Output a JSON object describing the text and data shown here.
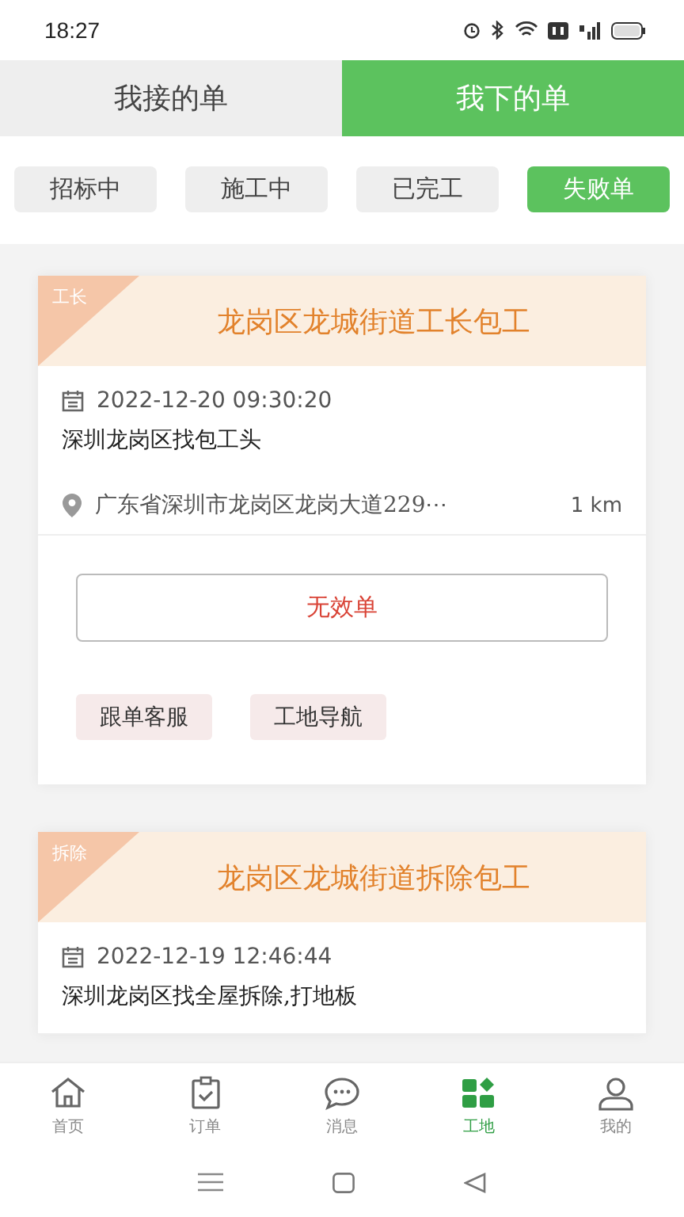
{
  "status_bar": {
    "time": "18:27"
  },
  "tabs": [
    {
      "label": "我接的单",
      "selected": false
    },
    {
      "label": "我下的单",
      "selected": true
    }
  ],
  "filters": [
    {
      "label": "招标中",
      "selected": false
    },
    {
      "label": "施工中",
      "selected": false
    },
    {
      "label": "已完工",
      "selected": false
    },
    {
      "label": "失败单",
      "selected": true
    }
  ],
  "orders": [
    {
      "tag": "工长",
      "title": "龙岗区龙城街道工长包工",
      "date": "2022-12-20 09:30:20",
      "description": "深圳龙岗区找包工头",
      "address": "广东省深圳市龙岗区龙岗大道229⋯",
      "distance": "1 km",
      "status_button": "无效单",
      "actions": [
        "跟单客服",
        "工地导航"
      ]
    },
    {
      "tag": "拆除",
      "title": "龙岗区龙城街道拆除包工",
      "date": "2022-12-19 12:46:44",
      "description": "深圳龙岗区找全屋拆除,打地板"
    }
  ],
  "bottom_nav": [
    {
      "label": "首页",
      "kind": "home",
      "selected": false
    },
    {
      "label": "订单",
      "kind": "order",
      "selected": false
    },
    {
      "label": "消息",
      "kind": "message",
      "selected": false
    },
    {
      "label": "工地",
      "kind": "site",
      "selected": true
    },
    {
      "label": "我的",
      "kind": "profile",
      "selected": false
    }
  ]
}
